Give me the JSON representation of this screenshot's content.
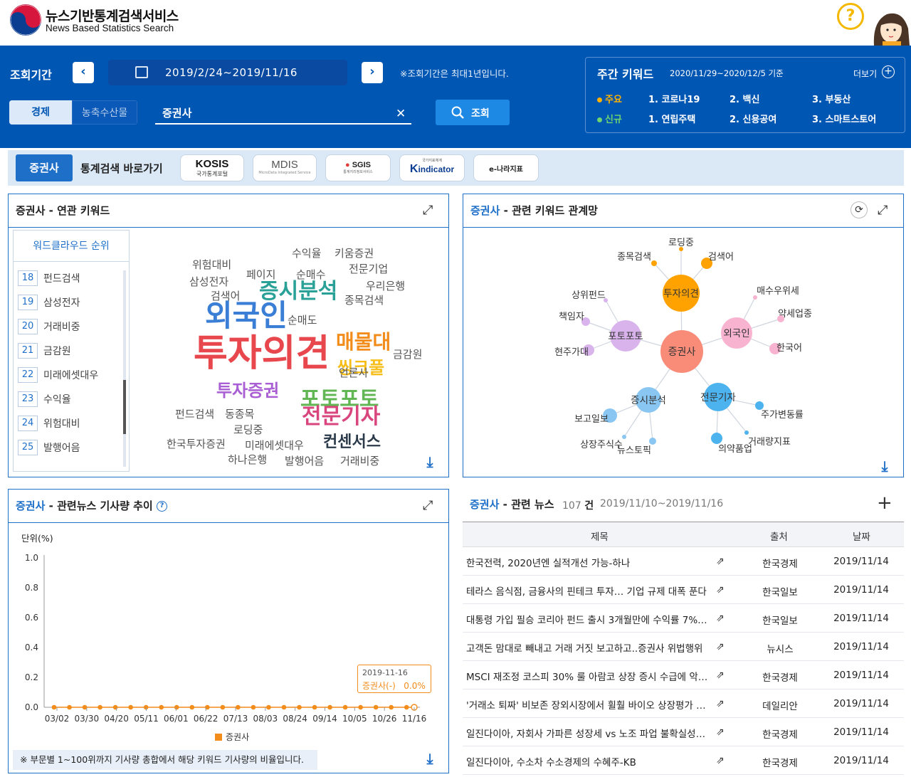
{
  "header": {
    "title_ko": "뉴스기반통계검색서비스",
    "title_en": "News Based Statistics Search",
    "help_icon": "?"
  },
  "search": {
    "period_label": "조회기간",
    "date_range": "2019/2/24~2019/11/16",
    "period_note": "※조회기간은 최대1년입니다.",
    "tabs": [
      "경제",
      "농축수산물"
    ],
    "active_tab": "경제",
    "keyword": "증권사",
    "query_label": "조회"
  },
  "weekly": {
    "title": "주간 키워드",
    "range": "2020/11/29~2020/12/5 기준",
    "more_label": "더보기",
    "major_label": "주요",
    "new_label": "신규",
    "major_items": [
      "1. 코로나19",
      "2. 백신",
      "3. 부동산"
    ],
    "new_items": [
      "1. 연립주택",
      "2. 신용공여",
      "3. 스마트스토어"
    ],
    "major_color": "#ffb300",
    "new_color": "#6fd36f"
  },
  "shortcut": {
    "keyword": "증권사",
    "label": "통계검색 바로가기",
    "sites": [
      {
        "main": "KOSIS",
        "sub": "국가통계포털"
      },
      {
        "main": "MDIS",
        "sub": "MicroData Integrated Service"
      },
      {
        "main": "SGIS",
        "sub": "통계지리정보서비스"
      },
      {
        "main": "indicator",
        "sub": "국가지표체계"
      },
      {
        "main": "e-나라지표",
        "sub": ""
      }
    ]
  },
  "related_keywords": {
    "keyword": "증권사",
    "title_suffix": "- 연관 키워드",
    "rank_header": "워드클라우드 순위",
    "ranks": [
      {
        "no": "18",
        "kw": "펀드검색"
      },
      {
        "no": "19",
        "kw": "삼성전자"
      },
      {
        "no": "20",
        "kw": "거래비중"
      },
      {
        "no": "21",
        "kw": "금감원"
      },
      {
        "no": "22",
        "kw": "미래에셋대우"
      },
      {
        "no": "23",
        "kw": "수익율"
      },
      {
        "no": "24",
        "kw": "위험대비"
      },
      {
        "no": "25",
        "kw": "발행어음"
      }
    ],
    "cloud": [
      {
        "w": "투자의견",
        "color": "#e8474d"
      },
      {
        "w": "외국인",
        "color": "#3a7ed6"
      },
      {
        "w": "증시분석",
        "color": "#2aa197"
      },
      {
        "w": "포토포토",
        "color": "#62b653"
      },
      {
        "w": "전문기자",
        "color": "#d9467e"
      },
      {
        "w": "매물대",
        "color": "#f28c1b"
      },
      {
        "w": "씽크풀",
        "color": "#f7be1a"
      },
      {
        "w": "투자증권",
        "color": "#a95ed3"
      },
      {
        "w": "컨센서스",
        "color": "#2b3a4a"
      },
      {
        "w": "수익율",
        "color": "#555"
      },
      {
        "w": "키움증권",
        "color": "#555"
      },
      {
        "w": "위험대비",
        "color": "#555"
      },
      {
        "w": "페이지",
        "color": "#555"
      },
      {
        "w": "순매수",
        "color": "#555"
      },
      {
        "w": "전문기업",
        "color": "#555"
      },
      {
        "w": "삼성전자",
        "color": "#555"
      },
      {
        "w": "우리은행",
        "color": "#555"
      },
      {
        "w": "검색어",
        "color": "#555"
      },
      {
        "w": "종목검색",
        "color": "#555"
      },
      {
        "w": "순매도",
        "color": "#555"
      },
      {
        "w": "금감원",
        "color": "#555"
      },
      {
        "w": "언론사",
        "color": "#555"
      },
      {
        "w": "펀드검색",
        "color": "#555"
      },
      {
        "w": "동종목",
        "color": "#555"
      },
      {
        "w": "로딩중",
        "color": "#555"
      },
      {
        "w": "한국투자증권",
        "color": "#555"
      },
      {
        "w": "미래에셋대우",
        "color": "#555"
      },
      {
        "w": "하나은행",
        "color": "#555"
      },
      {
        "w": "발행어음",
        "color": "#555"
      },
      {
        "w": "거래비중",
        "color": "#555"
      }
    ]
  },
  "network": {
    "keyword": "증권사",
    "title_suffix": "- 관련 키워드 관계망",
    "center": "증권사",
    "hubs": [
      "투자의견",
      "포토포토",
      "외국인",
      "증시분석",
      "전문기자"
    ],
    "leaves": [
      "로딩중",
      "종목검색",
      "검색어",
      "상위펀드",
      "책임자",
      "현주가대",
      "매수우위세",
      "약세업종",
      "한국어",
      "보고일보",
      "상장주식수",
      "뉴스토픽",
      "주가변동률",
      "거래량지표",
      "의약품업"
    ]
  },
  "trend": {
    "keyword": "증권사",
    "title_suffix": "- 관련뉴스 기사량 추이",
    "unit": "단위(%)",
    "note": "※ 부문별 1~100위까지 기사량 총합에서 해당 키워드 기사량의 비율입니다.",
    "tooltip_date": "2019-11-16",
    "tooltip_value": "증권사(-)   0.0%"
  },
  "chart_data": {
    "type": "line",
    "x": [
      "03/02",
      "03/30",
      "04/20",
      "05/11",
      "06/01",
      "06/22",
      "07/13",
      "08/03",
      "08/24",
      "09/14",
      "10/05",
      "10/26",
      "11/16"
    ],
    "series": [
      {
        "name": "증권사",
        "values": [
          0.0,
          0.0,
          0.0,
          0.0,
          0.0,
          0.0,
          0.0,
          0.0,
          0.0,
          0.0,
          0.0,
          0.0,
          0.0
        ]
      }
    ],
    "title": "",
    "xlabel": "",
    "ylabel": "단위(%)",
    "ylim": [
      0.0,
      1.0
    ],
    "yticks": [
      "0.0",
      "0.2",
      "0.4",
      "0.6",
      "0.8",
      "1.0"
    ],
    "legend": "bottom",
    "color": "#f28c1b"
  },
  "news": {
    "keyword": "증권사",
    "title_suffix": "- 관련 뉴스",
    "count": "107",
    "count_unit": "건",
    "range": "2019/11/10~2019/11/16",
    "columns": [
      "제목",
      "출처",
      "날짜"
    ],
    "rows": [
      {
        "title": "한국전력, 2020년엔 실적개선 가능-하나",
        "source": "한국경제",
        "date": "2019/11/14"
      },
      {
        "title": "테라스 음식점, 금융사의 핀테크 투자… 기업 규제 대폭 푼다",
        "source": "한국일보",
        "date": "2019/11/14"
      },
      {
        "title": "대통령 가입 필승 코리아 펀드 출시 3개월만에 수익률 7%…",
        "source": "한국일보",
        "date": "2019/11/14"
      },
      {
        "title": "고객돈 맘대로 빼내고 거래 거짓 보고하고..증권사 위법행위",
        "source": "뉴시스",
        "date": "2019/11/14"
      },
      {
        "title": "MSCI 재조정 코스피 30% 룰 아람코 상장 증시 수급에 악…",
        "source": "한국경제",
        "date": "2019/11/14"
      },
      {
        "title": "'거래소 퇴짜' 비보존 장외시장에서 휠훨 바이오 상장평가 …",
        "source": "데일리안",
        "date": "2019/11/14"
      },
      {
        "title": "일진다이아, 자회사 가파른 성장세 vs 노조 파업 불확실성…",
        "source": "한국경제",
        "date": "2019/11/14"
      },
      {
        "title": "일진다이아, 수소차 수소경제의 수혜주-KB",
        "source": "한국경제",
        "date": "2019/11/14"
      }
    ]
  }
}
